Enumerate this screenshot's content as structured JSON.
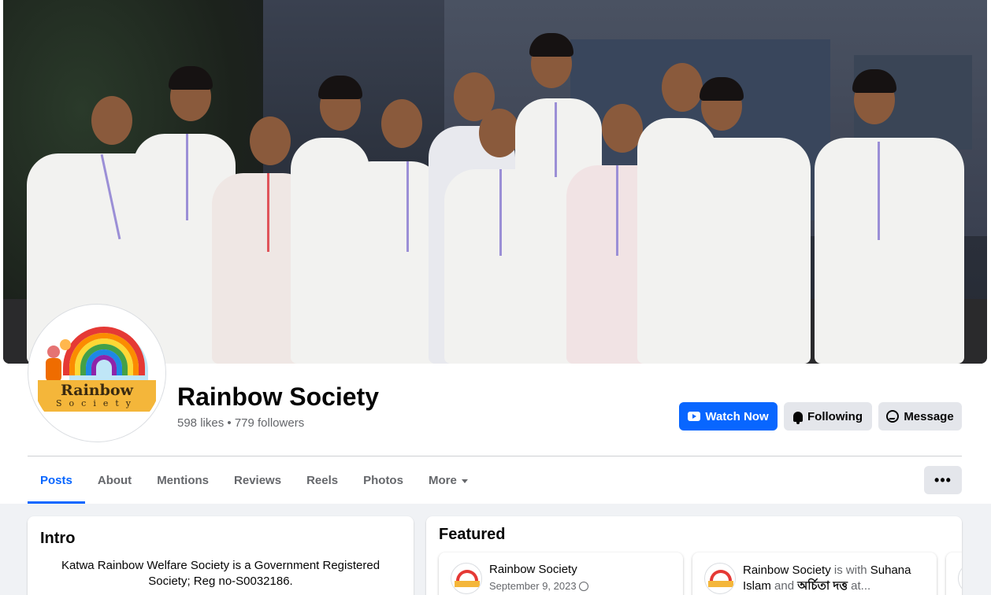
{
  "page": {
    "name": "Rainbow Society",
    "likes": "598 likes",
    "separator": "•",
    "followers": "779 followers"
  },
  "avatar": {
    "logo_title": "Rainbow",
    "logo_subtitle": "Society"
  },
  "actions": {
    "watch_now": "Watch Now",
    "following": "Following",
    "message": "Message",
    "more": "•••"
  },
  "tabs": [
    {
      "label": "Posts",
      "active": true
    },
    {
      "label": "About"
    },
    {
      "label": "Mentions"
    },
    {
      "label": "Reviews"
    },
    {
      "label": "Reels"
    },
    {
      "label": "Photos"
    },
    {
      "label": "More"
    }
  ],
  "intro": {
    "title": "Intro",
    "text": "Katwa Rainbow Welfare Society is a Government Registered Society; Reg no-S0032186."
  },
  "featured": {
    "title": "Featured",
    "posts": [
      {
        "author": "Rainbow Society",
        "date": "September 9, 2023"
      },
      {
        "author": "Rainbow Society",
        "with_text": "is with",
        "tag1": "Suhana Islam",
        "and_text": "and",
        "tag2": "অর্চিতা দত্ত",
        "at_text": "at..."
      }
    ]
  },
  "colors": {
    "accent": "#0866ff",
    "secondary_button": "#e4e6eb",
    "muted_text": "#65676b",
    "background": "#f0f2f5"
  },
  "icons": {
    "watch_now": "play-video-icon",
    "following": "bell-icon",
    "message": "messenger-icon",
    "more_tab": "caret-down-icon",
    "date": "globe-icon"
  }
}
